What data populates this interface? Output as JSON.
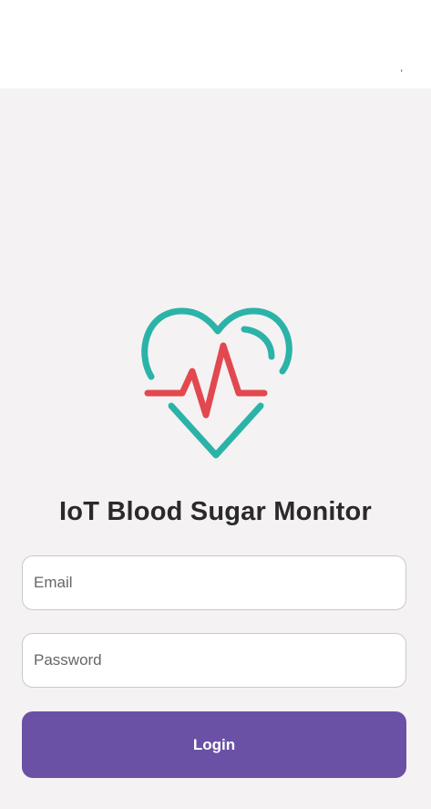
{
  "app": {
    "title": "IoT Blood Sugar Monitor",
    "status_mark": "ʼ"
  },
  "logo": {
    "icon": "heart-pulse-icon",
    "heart_color": "#2bb3a8",
    "pulse_color": "#e2484f"
  },
  "login_form": {
    "email": {
      "placeholder": "Email",
      "value": ""
    },
    "password": {
      "placeholder": "Password",
      "value": ""
    },
    "login_label": "Login"
  },
  "colors": {
    "background": "#f4f2f3",
    "primary": "#6a51a6"
  }
}
